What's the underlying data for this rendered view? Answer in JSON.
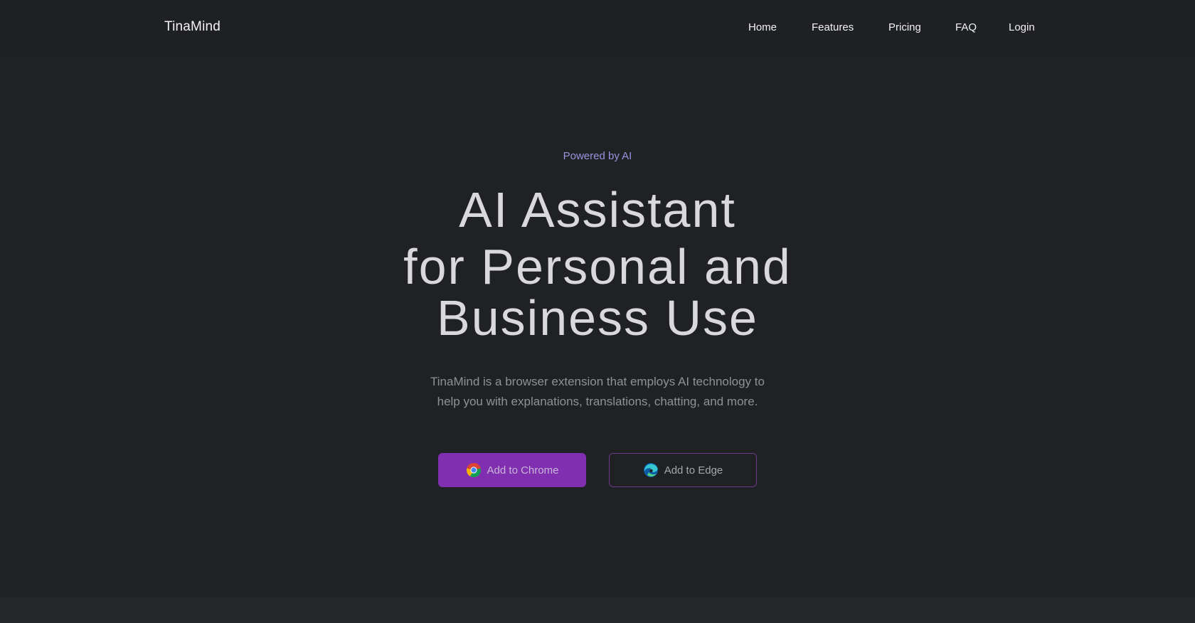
{
  "brand": {
    "name": "TinaMind"
  },
  "nav": {
    "items": [
      {
        "label": "Home"
      },
      {
        "label": "Features"
      },
      {
        "label": "Pricing"
      },
      {
        "label": "FAQ"
      },
      {
        "label": "Login"
      }
    ]
  },
  "hero": {
    "eyebrow": "Powered by AI",
    "headline_line1": "AI Assistant",
    "headline_line2": "for Personal and",
    "headline_line3": "Business Use",
    "description_line1": "TinaMind is a browser extension that employs AI technology to",
    "description_line2": "help you with explanations, translations, chatting, and more.",
    "buttons": {
      "chrome": {
        "label": "Add to Chrome",
        "icon": "chrome-icon"
      },
      "edge": {
        "label": "Add to Edge",
        "icon": "edge-icon"
      }
    }
  },
  "colors": {
    "background": "#1f2124",
    "accent": "#7f2fb0",
    "eyebrow": "#9a94df"
  }
}
